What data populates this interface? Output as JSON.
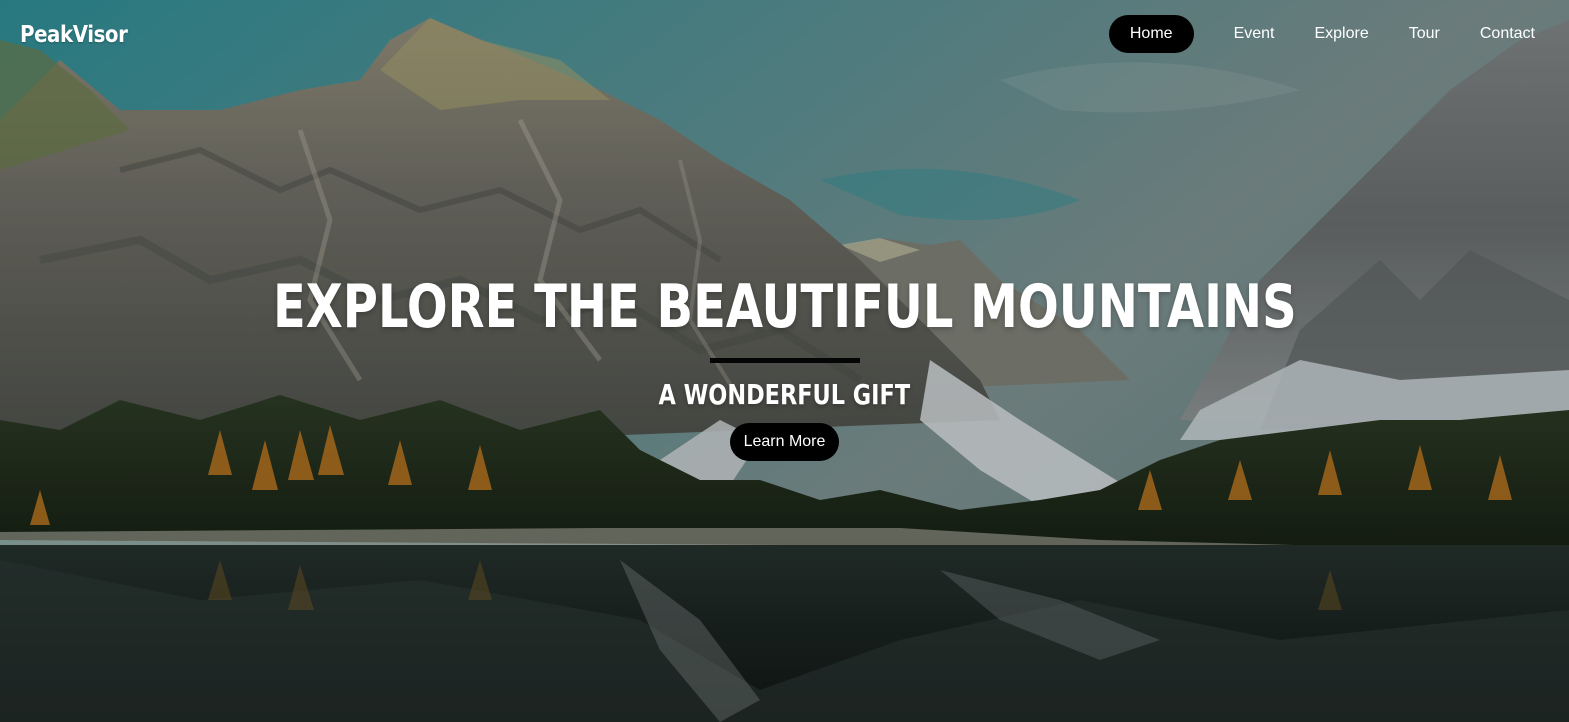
{
  "brand": {
    "logo_text": "PeakVisor"
  },
  "nav": {
    "items": [
      {
        "label": "Home",
        "active": true
      },
      {
        "label": "Event",
        "active": false
      },
      {
        "label": "Explore",
        "active": false
      },
      {
        "label": "Tour",
        "active": false
      },
      {
        "label": "Contact",
        "active": false
      }
    ]
  },
  "hero": {
    "headline": "EXPLORE THE BEAUTIFUL MOUNTAINS",
    "subheadline": "A WONDERFUL GIFT",
    "cta_label": "Learn More",
    "background_image": "mountain-lake-landscape"
  },
  "colors": {
    "nav_active_bg": "#000000",
    "text": "#ffffff",
    "divider": "#050505",
    "button_bg": "#000000"
  }
}
